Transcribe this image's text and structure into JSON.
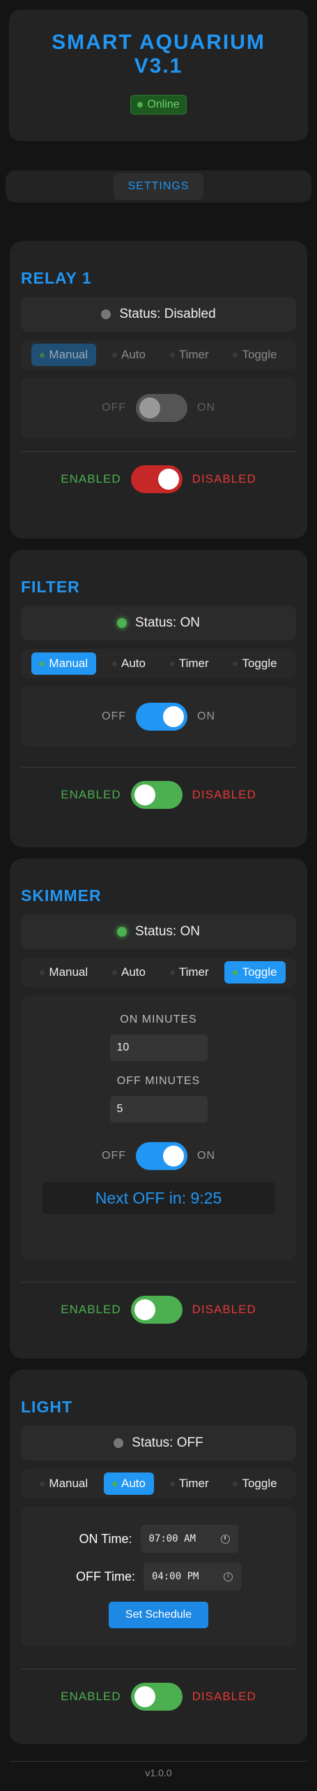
{
  "header": {
    "title_line1": "SMART AQUARIUM",
    "title_line2": "V3.1",
    "status": "Online"
  },
  "settings": {
    "label": "SETTINGS"
  },
  "modes": [
    "Manual",
    "Auto",
    "Timer",
    "Toggle"
  ],
  "switch_labels": {
    "off": "OFF",
    "on": "ON",
    "enabled": "ENABLED",
    "disabled": "DISABLED"
  },
  "relays": [
    {
      "name": "RELAY 1",
      "status": "Status: Disabled",
      "active_mode": "Manual",
      "output": "off",
      "enabled": false
    },
    {
      "name": "FILTER",
      "status": "Status: ON",
      "active_mode": "Manual",
      "output": "on",
      "enabled": true
    },
    {
      "name": "SKIMMER",
      "status": "Status: ON",
      "active_mode": "Toggle",
      "toggle": {
        "on_minutes_label": "ON MINUTES",
        "on_minutes": "10",
        "off_minutes_label": "OFF MINUTES",
        "off_minutes": "5",
        "next_off": "Next OFF in: 9:25"
      },
      "output": "on",
      "enabled": true
    },
    {
      "name": "LIGHT",
      "status": "Status: OFF",
      "active_mode": "Auto",
      "schedule": {
        "on_label": "ON Time:",
        "on_time": "07:00 AM",
        "off_label": "OFF Time:",
        "off_time": "04:00 PM",
        "button": "Set Schedule"
      },
      "enabled": true
    }
  ],
  "footer": {
    "version": "v1.0.0"
  },
  "colors": {
    "accent": "#2196f3",
    "enabled_green": "#4caf50",
    "disabled_red": "#e53935",
    "background": "#141414",
    "card": "#232323"
  }
}
